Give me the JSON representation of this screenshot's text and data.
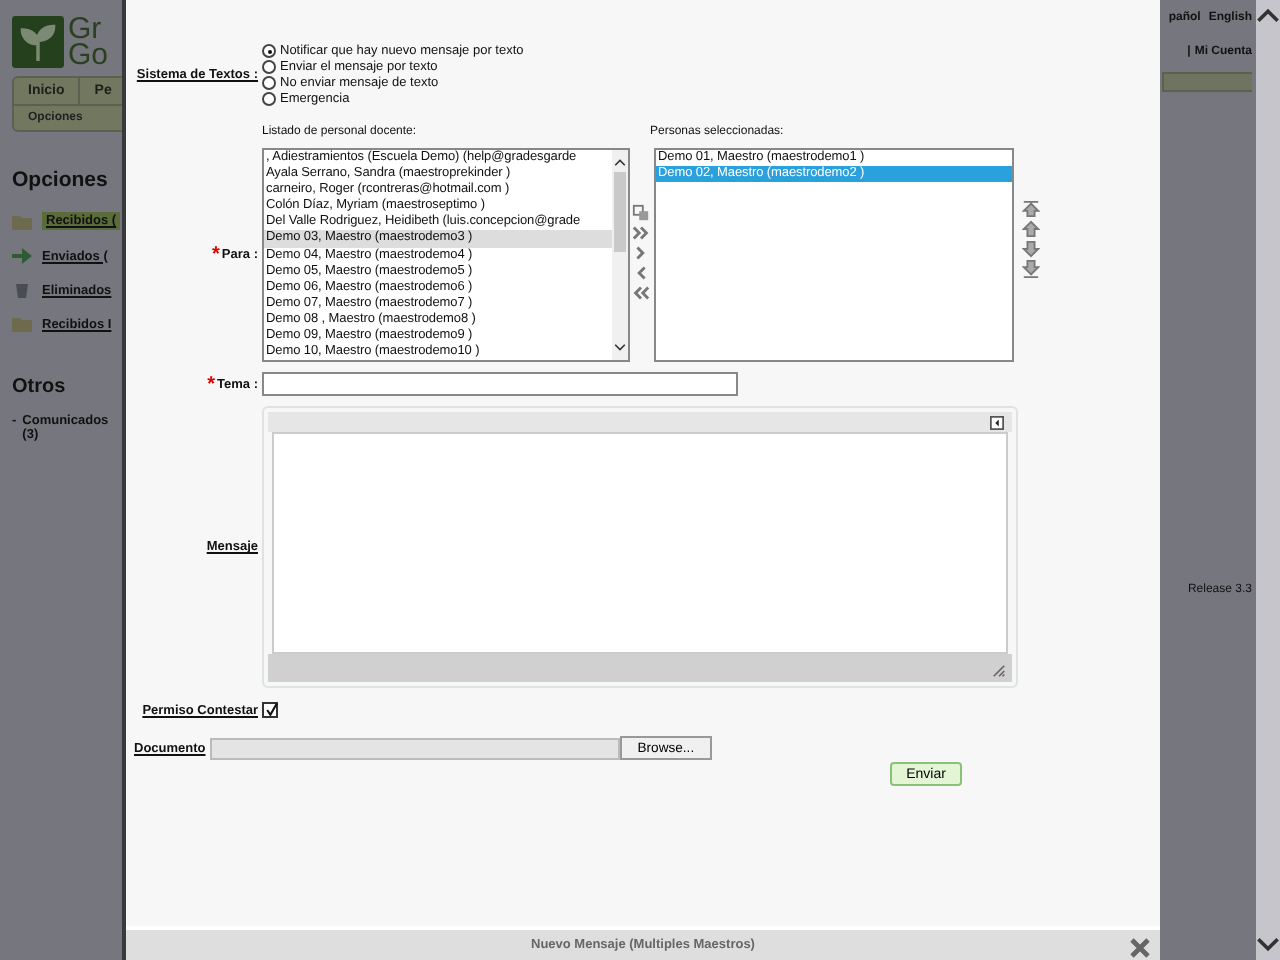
{
  "background_page": {
    "logo": {
      "line_1": "Gr",
      "line_2": "Go"
    },
    "nav_tabs": [
      "Inicio",
      "Pe"
    ],
    "subnav": "Opciones",
    "heading": "Opciones",
    "folders": [
      {
        "label": "Recibidos (",
        "kind": "folder",
        "selected": true
      },
      {
        "label": "Enviados (",
        "kind": "sent",
        "selected": false
      },
      {
        "label": "Eliminados",
        "kind": "trash",
        "selected": false
      },
      {
        "label": "Recibidos I",
        "kind": "folder",
        "selected": false
      }
    ],
    "other_heading": "Otros",
    "other_items": [
      {
        "bullet": "-",
        "label": "Comunicados (3)"
      }
    ],
    "languages": [
      "pañol",
      "English"
    ],
    "separator": "|",
    "account_link": "Mi Cuenta",
    "release": "Release 3.3"
  },
  "dialog": {
    "title": "Nuevo Mensaje (Multiples Maestros)",
    "text_system": {
      "label": "Sistema de Textos :",
      "options": [
        {
          "label": "Notificar que hay nuevo mensaje por texto",
          "selected": true
        },
        {
          "label": "Enviar el mensaje por texto",
          "selected": false
        },
        {
          "label": "No enviar mensaje de texto",
          "selected": false
        },
        {
          "label": "Emergencia",
          "selected": false
        }
      ]
    },
    "available_label": "Listado de personal docente:",
    "selected_label": "Personas seleccionadas:",
    "to": {
      "required_mark": "*",
      "label": "Para :"
    },
    "available": [
      {
        "text": ", Adiestramientos (Escuela Demo) (help@gradesgarde",
        "selected": false
      },
      {
        "text": "Ayala Serrano, Sandra (maestroprekinder )",
        "selected": false
      },
      {
        "text": "carneiro, Roger (rcontreras@hotmail.com )",
        "selected": false
      },
      {
        "text": "Colón Díaz, Myriam (maestroseptimo )",
        "selected": false
      },
      {
        "text": "Del Valle Rodriguez, Heidibeth (luis.concepcion@grade",
        "selected": false
      },
      {
        "text": "Demo 03, Maestro (maestrodemo3 )",
        "selected": true
      },
      {
        "text": "Demo 04, Maestro (maestrodemo4 )",
        "selected": false
      },
      {
        "text": "Demo 05, Maestro (maestrodemo5 )",
        "selected": false
      },
      {
        "text": "Demo 06, Maestro (maestrodemo6 )",
        "selected": false
      },
      {
        "text": "Demo 07, Maestro (maestrodemo7 )",
        "selected": false
      },
      {
        "text": "Demo 08 , Maestro (maestrodemo8 )",
        "selected": false
      },
      {
        "text": "Demo 09, Maestro (maestrodemo9 )",
        "selected": false
      },
      {
        "text": "Demo 10, Maestro (maestrodemo10 )",
        "selected": false
      }
    ],
    "chosen": [
      {
        "text": "Demo 01, Maestro (maestrodemo1 )",
        "selected": false
      },
      {
        "text": "Demo 02, Maestro (maestrodemo2 )",
        "selected": true
      }
    ],
    "subject": {
      "required_mark": "*",
      "label": "Tema :"
    },
    "message_label": "Mensaje",
    "reply_permission": {
      "label": "Permiso Contestar",
      "checked": true
    },
    "document": {
      "label": "Documento",
      "button": "Browse..."
    },
    "send_button": "Enviar"
  }
}
